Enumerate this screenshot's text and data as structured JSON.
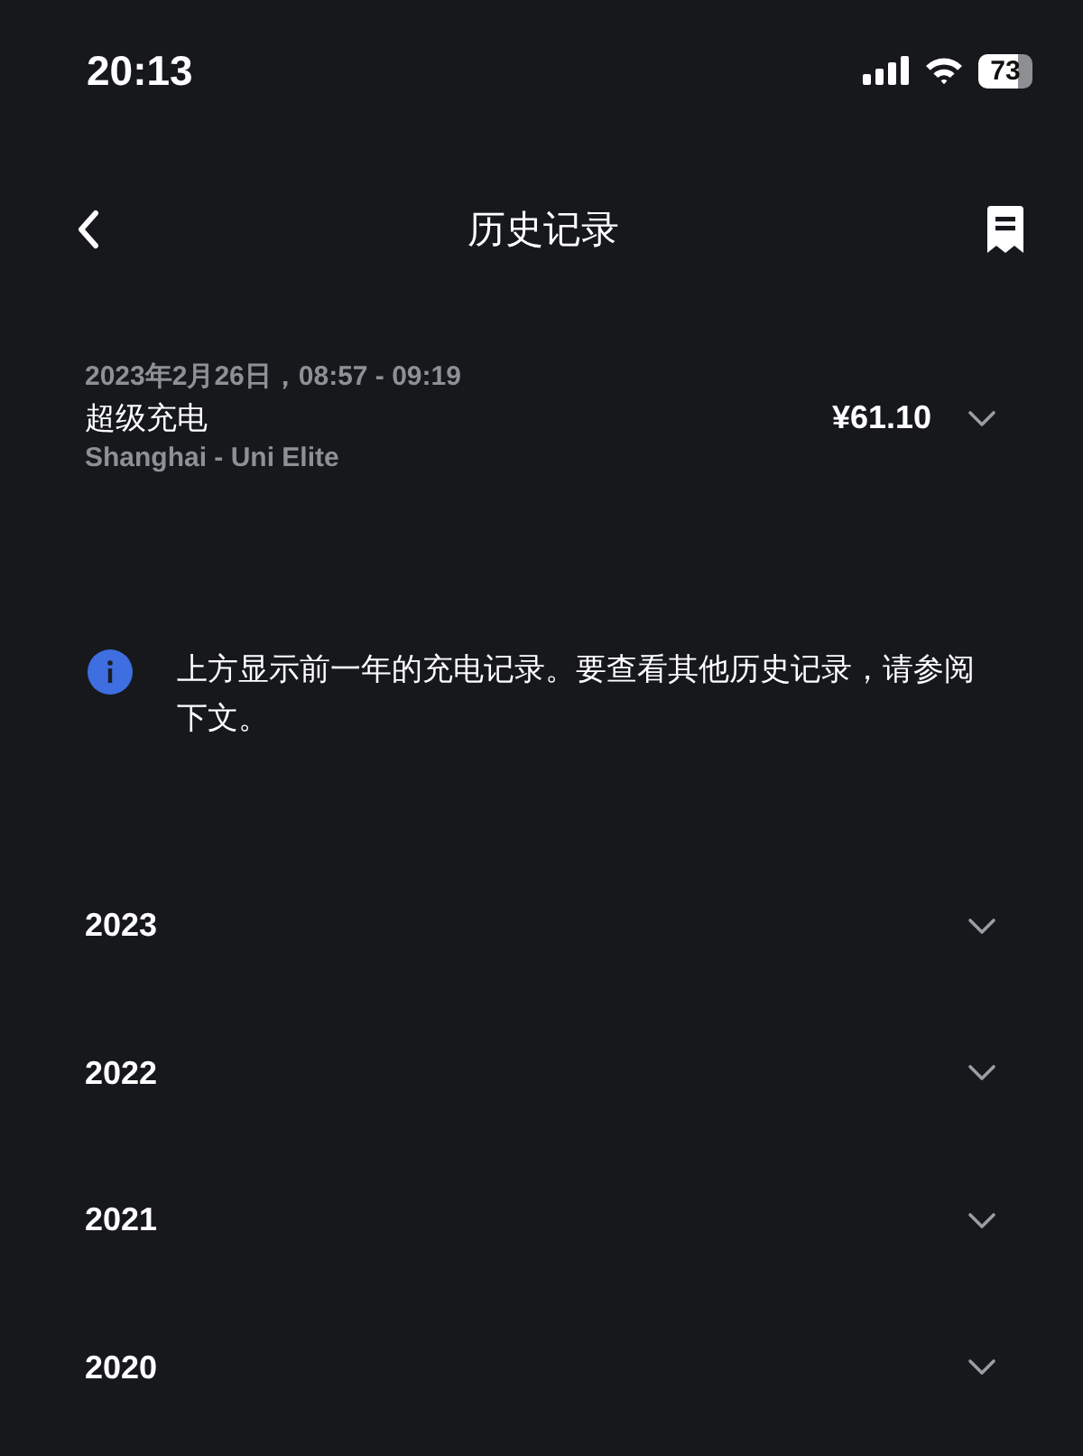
{
  "status_bar": {
    "time": "20:13",
    "battery": "73"
  },
  "header": {
    "title": "历史记录"
  },
  "recent": [
    {
      "date": "2023年2月26日，08:57 - 09:19",
      "type": "超级充电",
      "location": "Shanghai - Uni Elite",
      "amount": "¥61.10",
      "expanded": false
    }
  ],
  "notice": {
    "text": "上方显示前一年的充电记录。要查看其他历史记录，请参阅下文。"
  },
  "years": [
    {
      "label": "2023",
      "expanded": false
    },
    {
      "label": "2022",
      "expanded": false
    },
    {
      "label": "2021",
      "expanded": false
    },
    {
      "label": "2020",
      "expanded": false
    }
  ]
}
